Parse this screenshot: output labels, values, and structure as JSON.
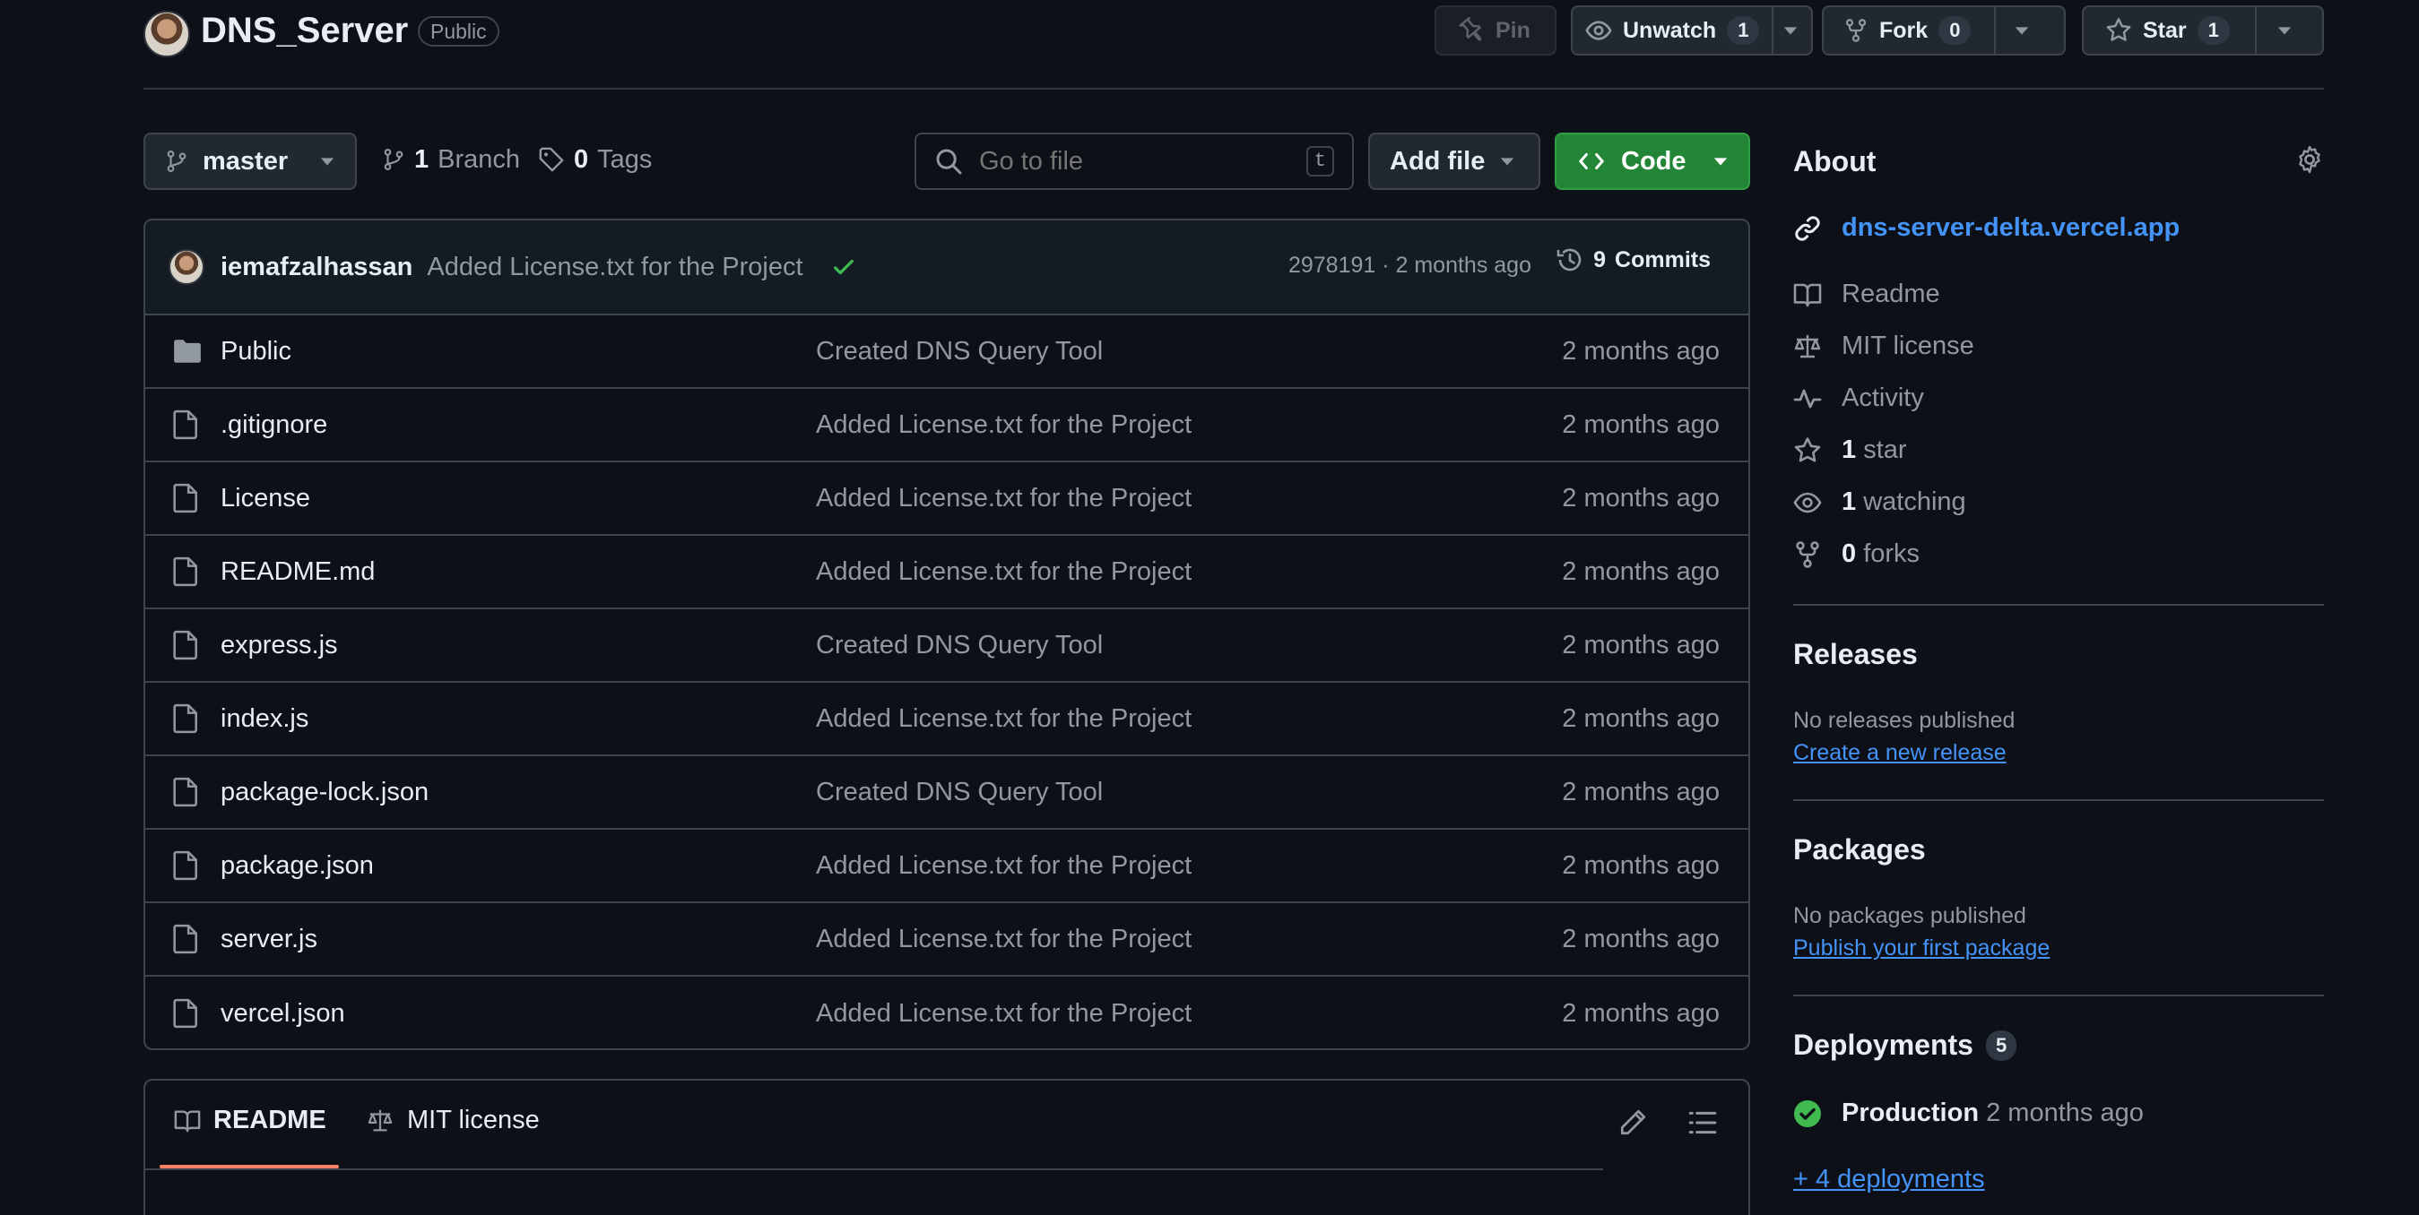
{
  "repo": {
    "name": "DNS_Server",
    "visibility": "Public"
  },
  "header_actions": {
    "pin": "Pin",
    "unwatch": "Unwatch",
    "unwatch_count": "1",
    "fork": "Fork",
    "fork_count": "0",
    "star": "Star",
    "star_count": "1"
  },
  "toolbar": {
    "branch": "master",
    "branches_count": "1",
    "branches_label": "Branch",
    "tags_count": "0",
    "tags_label": "Tags",
    "search_placeholder": "Go to file",
    "search_shortcut": "t",
    "add_file": "Add file",
    "code": "Code"
  },
  "latest_commit": {
    "author": "iemafzalhassan",
    "message": "Added License.txt for the Project",
    "meta": "2978191 · 2 months ago",
    "commits_count": "9",
    "commits_label": "Commits"
  },
  "files": [
    {
      "name": "Public",
      "type": "folder",
      "message": "Created DNS Query Tool",
      "date": "2 months ago"
    },
    {
      "name": ".gitignore",
      "type": "file",
      "message": "Added License.txt for the Project",
      "date": "2 months ago"
    },
    {
      "name": "License",
      "type": "file",
      "message": "Added License.txt for the Project",
      "date": "2 months ago"
    },
    {
      "name": "README.md",
      "type": "file",
      "message": "Added License.txt for the Project",
      "date": "2 months ago"
    },
    {
      "name": "express.js",
      "type": "file",
      "message": "Created DNS Query Tool",
      "date": "2 months ago"
    },
    {
      "name": "index.js",
      "type": "file",
      "message": "Added License.txt for the Project",
      "date": "2 months ago"
    },
    {
      "name": "package-lock.json",
      "type": "file",
      "message": "Created DNS Query Tool",
      "date": "2 months ago"
    },
    {
      "name": "package.json",
      "type": "file",
      "message": "Added License.txt for the Project",
      "date": "2 months ago"
    },
    {
      "name": "server.js",
      "type": "file",
      "message": "Added License.txt for the Project",
      "date": "2 months ago"
    },
    {
      "name": "vercel.json",
      "type": "file",
      "message": "Added License.txt for the Project",
      "date": "2 months ago"
    }
  ],
  "readme": {
    "tab_readme": "README",
    "tab_license": "MIT license"
  },
  "about": {
    "title": "About",
    "website": "dns-server-delta.vercel.app",
    "readme": "Readme",
    "license": "MIT license",
    "activity": "Activity",
    "stars_count": "1",
    "stars_label": "star",
    "watching_count": "1",
    "watching_label": "watching",
    "forks_count": "0",
    "forks_label": "forks"
  },
  "releases": {
    "title": "Releases",
    "empty": "No releases published",
    "create": "Create a new release"
  },
  "packages": {
    "title": "Packages",
    "empty": "No packages published",
    "publish": "Publish your first package"
  },
  "deployments": {
    "title": "Deployments",
    "count": "5",
    "production": "Production",
    "production_time": "2 months ago",
    "more": "+ 4 deployments"
  },
  "colors": {
    "background": "#0d1117",
    "border": "#3d444d",
    "accent_link": "#4493f8",
    "success_green": "#238636",
    "tab_underline": "#f78166"
  }
}
